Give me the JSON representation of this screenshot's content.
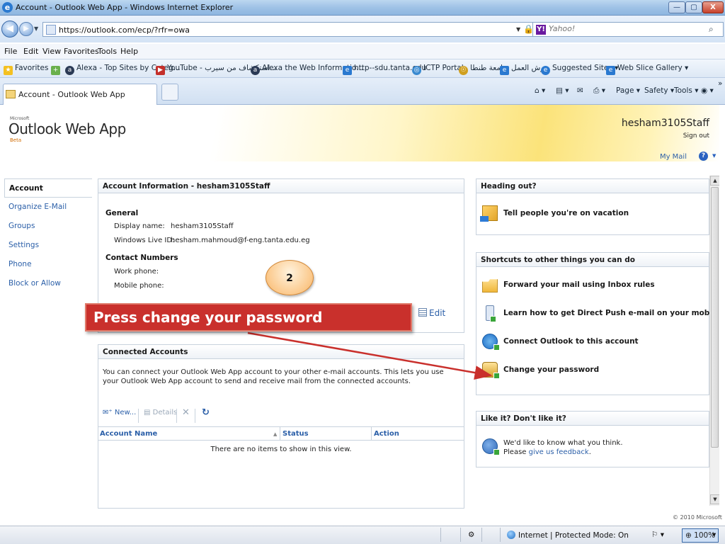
{
  "window": {
    "title": "Account - Outlook Web App - Windows Internet Explorer",
    "min": "—",
    "max": "▢",
    "close": "X"
  },
  "address": {
    "url": "https://outlook.com/ecp/?rfr=owa",
    "search_placeholder": "Yahoo!",
    "search_logo": "Y!"
  },
  "menu": [
    "File",
    "Edit",
    "View",
    "Favorites",
    "Tools",
    "Help"
  ],
  "favorites": {
    "label": "Favorites",
    "items": [
      {
        "label": "Alexa - Top Sites by Categ...",
        "icon": "alexa-icon",
        "color": "#2b3a55"
      },
      {
        "label": "YouTube - استكشاف من سيرب...",
        "icon": "youtube-icon",
        "color": "#c4302b"
      },
      {
        "label": "Alexa the Web Informatio...",
        "icon": "alexa-icon",
        "color": "#2b3a55"
      },
      {
        "label": "http--sdu.tanta.edu",
        "icon": "ie-page-icon",
        "color": "#2a79d0"
      },
      {
        "label": "ICTP Portal",
        "icon": "globe-icon",
        "color": "#3a8ad0"
      },
      {
        "label": "جامعة طنطا",
        "icon": "university-icon",
        "color": "#d0a020"
      },
      {
        "label": "ورش العمل",
        "icon": "ie-page-icon",
        "color": "#2a79d0"
      },
      {
        "label": "Suggested Sites ▾",
        "icon": "ie-icon",
        "color": "#2a79d0"
      },
      {
        "label": "Web Slice Gallery ▾",
        "icon": "ie-page-icon",
        "color": "#2a79d0"
      }
    ]
  },
  "tabs": {
    "active": "Account - Outlook Web App",
    "commands": [
      "Page ▾",
      "Safety ▾",
      "Tools ▾"
    ],
    "more": "»"
  },
  "owa": {
    "logo_ms": "Microsoft",
    "logo_name": "Outlook Web App",
    "logo_beta": "Beta",
    "user": "hesham3105Staff",
    "sign_out": "Sign out",
    "my_mail": "My Mail",
    "help": "?",
    "nav": [
      "Account",
      "Organize E-Mail",
      "Groups",
      "Settings",
      "Phone",
      "Block or Allow"
    ],
    "account_info": {
      "title": "Account Information - hesham3105Staff",
      "general": "General",
      "display_name_label": "Display name:",
      "display_name": "hesham3105Staff",
      "live_id_label": "Windows Live ID:",
      "live_id": "hesham.mahmoud@f-eng.tanta.edu.eg",
      "contact": "Contact Numbers",
      "work_label": "Work phone:",
      "mobile_label": "Mobile phone:",
      "edit": "Edit"
    },
    "connected": {
      "title": "Connected Accounts",
      "desc": "You can connect your Outlook Web App account to your other e-mail accounts. This lets you use your Outlook Web App account to send and receive mail from the connected accounts.",
      "new": "New...",
      "details": "Details",
      "delete": "✕",
      "refresh": "↻",
      "col_name": "Account Name",
      "col_status": "Status",
      "col_action": "Action",
      "sort_indicator": "▲",
      "empty": "There are no items to show in this view."
    },
    "heading_out": {
      "title": "Heading out?",
      "vacation": "Tell people you're on vacation"
    },
    "shortcuts": {
      "title": "Shortcuts to other things you can do",
      "items": [
        "Forward your mail using Inbox rules",
        "Learn how to get Direct Push e-mail on your mobile phone",
        "Connect Outlook to this account",
        "Change your password"
      ]
    },
    "feedback": {
      "title": "Like it? Don't like it?",
      "line1": "We'd like to know what you think.",
      "line2_prefix": "Please ",
      "line2_link": "give us feedback",
      "line2_suffix": "."
    },
    "copyright": "© 2010 Microsoft"
  },
  "annotation": {
    "step": "2",
    "callout": "Press change your password",
    "color": "#c9302c"
  },
  "status": {
    "zone": "Internet | Protected Mode: On",
    "zoom": "100%"
  }
}
